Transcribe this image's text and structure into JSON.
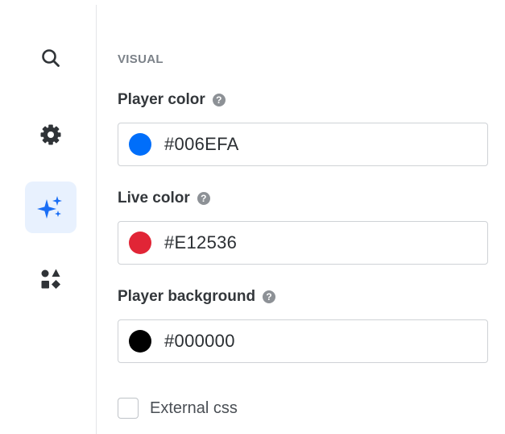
{
  "sidebar": {
    "items": [
      {
        "name": "search",
        "icon": "search-icon",
        "active": false
      },
      {
        "name": "settings",
        "icon": "gear-icon",
        "active": false
      },
      {
        "name": "appearance",
        "icon": "sparkles-icon",
        "active": true
      },
      {
        "name": "integrations",
        "icon": "shapes-icon",
        "active": false
      }
    ],
    "accent_color": "#1a6ef5",
    "active_bg": "#e8f1fe"
  },
  "visual": {
    "section_title": "VISUAL",
    "player_color": {
      "label": "Player color",
      "value": "#006EFA",
      "swatch": "#006efa"
    },
    "live_color": {
      "label": "Live color",
      "value": "#E12536",
      "swatch": "#e12536"
    },
    "player_background": {
      "label": "Player background",
      "value": "#000000",
      "swatch": "#000000"
    },
    "external_css": {
      "label": "External css",
      "checked": false
    }
  }
}
